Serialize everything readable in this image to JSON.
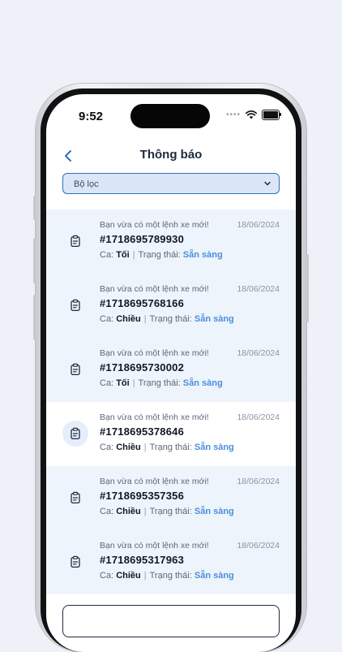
{
  "status": {
    "time": "9:52",
    "signal_dots": "••••",
    "wifi_icon": "wifi-icon",
    "battery_icon": "battery-icon"
  },
  "header": {
    "title": "Thông báo",
    "back_icon": "chevron-left-icon"
  },
  "filter": {
    "label": "Bộ lọc",
    "icon": "chevron-down-icon"
  },
  "notifications": [
    {
      "message": "Bạn vừa có một lệnh xe mới!",
      "date": "18/06/2024",
      "code": "#1718695789930",
      "shift_label": "Ca:",
      "shift": "Tối",
      "status_label": "Trạng thái:",
      "status": "Sẵn sàng",
      "state": "unread"
    },
    {
      "message": "Bạn vừa có một lệnh xe mới!",
      "date": "18/06/2024",
      "code": "#1718695768166",
      "shift_label": "Ca:",
      "shift": "Chiều",
      "status_label": "Trạng thái:",
      "status": "Sẵn sàng",
      "state": "unread"
    },
    {
      "message": "Bạn vừa có một lệnh xe mới!",
      "date": "18/06/2024",
      "code": "#1718695730002",
      "shift_label": "Ca:",
      "shift": "Tối",
      "status_label": "Trạng thái:",
      "status": "Sẵn sàng",
      "state": "unread"
    },
    {
      "message": "Bạn vừa có một lệnh xe mới!",
      "date": "18/06/2024",
      "code": "#1718695378646",
      "shift_label": "Ca:",
      "shift": "Chiều",
      "status_label": "Trạng thái:",
      "status": "Sẵn sàng",
      "state": "read"
    },
    {
      "message": "Bạn vừa có một lệnh xe mới!",
      "date": "18/06/2024",
      "code": "#1718695357356",
      "shift_label": "Ca:",
      "shift": "Chiều",
      "status_label": "Trạng thái:",
      "status": "Sẵn sàng",
      "state": "unread"
    },
    {
      "message": "Bạn vừa có một lệnh xe mới!",
      "date": "18/06/2024",
      "code": "#1718695317963",
      "shift_label": "Ca:",
      "shift": "Chiều",
      "status_label": "Trạng thái:",
      "status": "Sẵn sàng",
      "state": "unread"
    }
  ],
  "colors": {
    "accent": "#2f6fc4",
    "status_ready": "#4a8fdc",
    "unread_bg": "#eef4fc",
    "page_bg": "#eef2f8"
  }
}
